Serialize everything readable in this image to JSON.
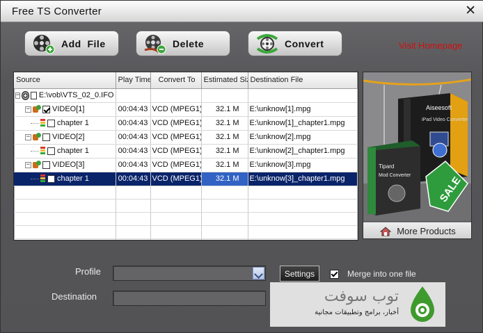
{
  "window": {
    "title": "Free TS Converter",
    "close_glyph": "✕"
  },
  "toolbar": {
    "add_file": {
      "label": "Add  File",
      "icon": "film-reel-add-icon"
    },
    "delete": {
      "label": "Delete",
      "icon": "film-reel-remove-icon"
    },
    "convert": {
      "label": "Convert",
      "icon": "convert-reel-icon"
    }
  },
  "visit_homepage": "Visit Homepage",
  "file_list": {
    "columns": [
      "Source",
      "Play Time",
      "Convert To",
      "Estimated Size",
      "Destination File"
    ],
    "source_path": "E:\\vob\\VTS_02_0.IFO",
    "rows": [
      {
        "level": 1,
        "checked": true,
        "source": "VIDEO[1]",
        "play_time": "00:04:43",
        "convert_to": "VCD (MPEG1)",
        "size": "32.1 M",
        "dest": "E:\\unknow[1].mpg",
        "selected": false
      },
      {
        "level": 2,
        "checked": false,
        "source": "chapter 1",
        "play_time": "00:04:43",
        "convert_to": "VCD (MPEG1)",
        "size": "32.1 M",
        "dest": "E:\\unknow[1]_chapter1.mpg",
        "selected": false
      },
      {
        "level": 1,
        "checked": false,
        "source": "VIDEO[2]",
        "play_time": "00:04:43",
        "convert_to": "VCD (MPEG1)",
        "size": "32.1 M",
        "dest": "E:\\unknow[2].mpg",
        "selected": false
      },
      {
        "level": 2,
        "checked": false,
        "source": "chapter 1",
        "play_time": "00:04:43",
        "convert_to": "VCD (MPEG1)",
        "size": "32.1 M",
        "dest": "E:\\unknow[2]_chapter1.mpg",
        "selected": false
      },
      {
        "level": 1,
        "checked": false,
        "source": "VIDEO[3]",
        "play_time": "00:04:43",
        "convert_to": "VCD (MPEG1)",
        "size": "32.1 M",
        "dest": "E:\\unknow[3].mpg",
        "selected": false
      },
      {
        "level": 2,
        "checked": false,
        "source": "chapter 1",
        "play_time": "00:04:43",
        "convert_to": "VCD (MPEG1)",
        "size": "32.1 M",
        "dest": "E:\\unknow[3]_chapter1.mpg",
        "selected": true
      }
    ]
  },
  "promo": {
    "box1_brand": "Aiseesoft",
    "box1_name": "iPad Video Converter",
    "box2_brand": "Tipard",
    "box2_name": "Mod Converter",
    "tag": "SALE",
    "more_products": "More Products"
  },
  "form": {
    "profile_label": "Profile",
    "profile_value": "",
    "settings_label": "Settings",
    "merge_label": "Merge into one file",
    "merge_checked": true,
    "destination_label": "Destination",
    "destination_value": ""
  },
  "watermark": {
    "name": "توب سوفت",
    "subtitle": "أخبار، برامج وتطبيقات مجانية"
  },
  "colors": {
    "selection": "#0a246a",
    "selection_size_cell": "#3162c4",
    "visit_link": "#d10f0f",
    "background": "#5b5b5e"
  }
}
